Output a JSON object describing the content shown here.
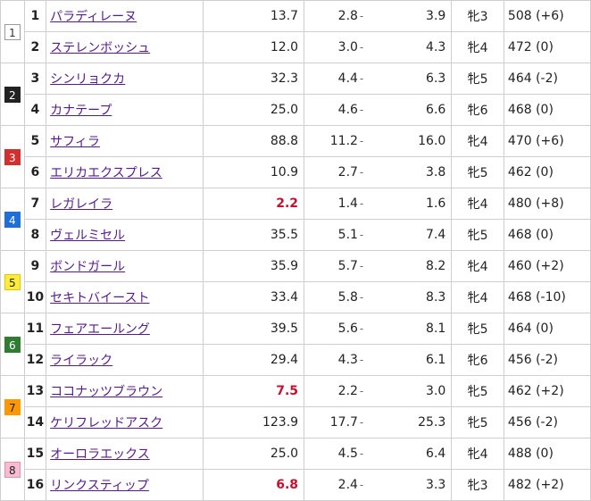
{
  "rows": [
    {
      "waku": "1",
      "num": "1",
      "name": "パラディレーヌ",
      "odds": "13.7",
      "pmin": "2.8",
      "pmax": "3.9",
      "sex": "牝3",
      "weight": "508 (+6)",
      "fav": false
    },
    {
      "waku": "",
      "num": "2",
      "name": "ステレンボッシュ",
      "odds": "12.0",
      "pmin": "3.0",
      "pmax": "4.3",
      "sex": "牝4",
      "weight": "472 (0)",
      "fav": false
    },
    {
      "waku": "2",
      "num": "3",
      "name": "シンリョクカ",
      "odds": "32.3",
      "pmin": "4.4",
      "pmax": "6.3",
      "sex": "牝5",
      "weight": "464 (-2)",
      "fav": false
    },
    {
      "waku": "",
      "num": "4",
      "name": "カナテープ",
      "odds": "25.0",
      "pmin": "4.6",
      "pmax": "6.6",
      "sex": "牝6",
      "weight": "468 (0)",
      "fav": false
    },
    {
      "waku": "3",
      "num": "5",
      "name": "サフィラ",
      "odds": "88.8",
      "pmin": "11.2",
      "pmax": "16.0",
      "sex": "牝4",
      "weight": "470 (+6)",
      "fav": false
    },
    {
      "waku": "",
      "num": "6",
      "name": "エリカエクスプレス",
      "odds": "10.9",
      "pmin": "2.7",
      "pmax": "3.8",
      "sex": "牝5",
      "weight": "462 (0)",
      "fav": false
    },
    {
      "waku": "4",
      "num": "7",
      "name": "レガレイラ",
      "odds": "2.2",
      "pmin": "1.4",
      "pmax": "1.6",
      "sex": "牝4",
      "weight": "480 (+8)",
      "fav": true
    },
    {
      "waku": "",
      "num": "8",
      "name": "ヴェルミセル",
      "odds": "35.5",
      "pmin": "5.1",
      "pmax": "7.4",
      "sex": "牝5",
      "weight": "468 (0)",
      "fav": false
    },
    {
      "waku": "5",
      "num": "9",
      "name": "ボンドガール",
      "odds": "35.9",
      "pmin": "5.7",
      "pmax": "8.2",
      "sex": "牝4",
      "weight": "460 (+2)",
      "fav": false
    },
    {
      "waku": "",
      "num": "10",
      "name": "セキトバイースト",
      "odds": "33.4",
      "pmin": "5.8",
      "pmax": "8.3",
      "sex": "牝4",
      "weight": "468 (-10)",
      "fav": false
    },
    {
      "waku": "6",
      "num": "11",
      "name": "フェアエールング",
      "odds": "39.5",
      "pmin": "5.6",
      "pmax": "8.1",
      "sex": "牝5",
      "weight": "464 (0)",
      "fav": false
    },
    {
      "waku": "",
      "num": "12",
      "name": "ライラック",
      "odds": "29.4",
      "pmin": "4.3",
      "pmax": "6.1",
      "sex": "牝6",
      "weight": "456 (-2)",
      "fav": false
    },
    {
      "waku": "7",
      "num": "13",
      "name": "ココナッツブラウン",
      "odds": "7.5",
      "pmin": "2.2",
      "pmax": "3.0",
      "sex": "牝5",
      "weight": "462 (+2)",
      "fav": true
    },
    {
      "waku": "",
      "num": "14",
      "name": "ケリフレッドアスク",
      "odds": "123.9",
      "pmin": "17.7",
      "pmax": "25.3",
      "sex": "牝5",
      "weight": "456 (-2)",
      "fav": false
    },
    {
      "waku": "8",
      "num": "15",
      "name": "オーロラエックス",
      "odds": "25.0",
      "pmin": "4.5",
      "pmax": "6.4",
      "sex": "牝4",
      "weight": "488 (0)",
      "fav": false
    },
    {
      "waku": "",
      "num": "16",
      "name": "リンクスティップ",
      "odds": "6.8",
      "pmin": "2.4",
      "pmax": "3.3",
      "sex": "牝3",
      "weight": "482 (+2)",
      "fav": true
    }
  ],
  "waku_colors": {
    "1": {
      "bg": "#ffffff",
      "fg": "#333333",
      "border": "#999999"
    },
    "2": {
      "bg": "#222222",
      "fg": "#ffffff",
      "border": "#222222"
    },
    "3": {
      "bg": "#d32f2f",
      "fg": "#ffffff",
      "border": "#d32f2f"
    },
    "4": {
      "bg": "#1e6fd9",
      "fg": "#ffffff",
      "border": "#1e6fd9"
    },
    "5": {
      "bg": "#ffeb3b",
      "fg": "#222222",
      "border": "#e0c800"
    },
    "6": {
      "bg": "#2e7d32",
      "fg": "#ffffff",
      "border": "#2e7d32"
    },
    "7": {
      "bg": "#ff9800",
      "fg": "#222222",
      "border": "#ff9800"
    },
    "8": {
      "bg": "#f8bbd0",
      "fg": "#222222",
      "border": "#e48fb0"
    }
  },
  "place_separator": "-",
  "favorite_color": "#c8102e"
}
